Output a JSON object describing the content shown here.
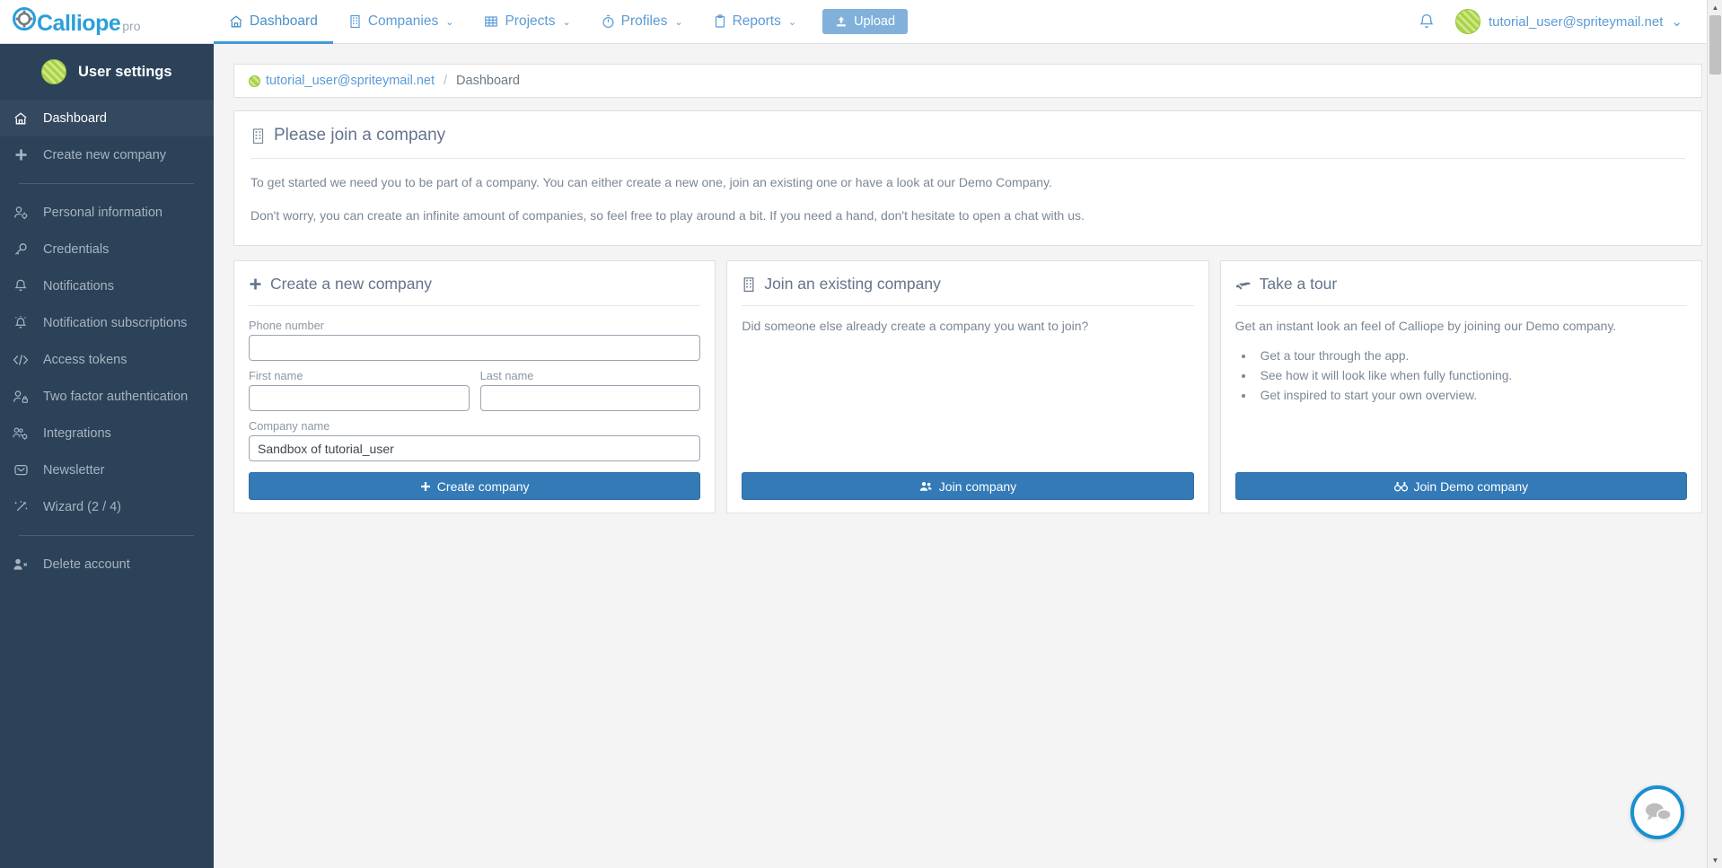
{
  "brand": {
    "name": "Calliope",
    "suffix": "pro"
  },
  "topnav": {
    "items": [
      {
        "label": "Dashboard",
        "icon": "home-icon",
        "caret": "",
        "active": true
      },
      {
        "label": "Companies",
        "icon": "building-icon",
        "caret": "⌄",
        "active": false
      },
      {
        "label": "Projects",
        "icon": "table-icon",
        "caret": "⌄",
        "active": false
      },
      {
        "label": "Profiles",
        "icon": "stopwatch-icon",
        "caret": "⌄",
        "active": false
      },
      {
        "label": "Reports",
        "icon": "clipboard-icon",
        "caret": "⌄",
        "active": false
      }
    ],
    "upload_label": "Upload",
    "notifications_icon": "bell-icon",
    "user_label": "tutorial_user@spriteymail.net",
    "user_caret": "⌄"
  },
  "sidebar": {
    "header_label": "User settings",
    "items": [
      {
        "label": "Dashboard",
        "icon": "home-icon",
        "active": true
      },
      {
        "label": "Create new company",
        "icon": "plus-icon",
        "active": false
      },
      {
        "label": "Personal information",
        "icon": "user-gear-icon",
        "active": false
      },
      {
        "label": "Credentials",
        "icon": "key-icon",
        "active": false
      },
      {
        "label": "Notifications",
        "icon": "bell-icon",
        "active": false
      },
      {
        "label": "Notification subscriptions",
        "icon": "bell-ring-icon",
        "active": false
      },
      {
        "label": "Access tokens",
        "icon": "code-icon",
        "active": false
      },
      {
        "label": "Two factor authentication",
        "icon": "user-lock-icon",
        "active": false
      },
      {
        "label": "Integrations",
        "icon": "users-gear-icon",
        "active": false
      },
      {
        "label": "Newsletter",
        "icon": "envelope-icon",
        "active": false
      },
      {
        "label": "Wizard (2 / 4)",
        "icon": "magic-wand-icon",
        "active": false
      },
      {
        "label": "Delete account",
        "icon": "user-remove-icon",
        "active": false
      }
    ]
  },
  "breadcrumb": {
    "root_label": "tutorial_user@spriteymail.net",
    "separator": "/",
    "current_label": "Dashboard"
  },
  "main_panel": {
    "title": "Please join a company",
    "title_icon": "building-icon",
    "paragraph_1": "To get started we need you to be part of a company. You can either create a new one, join an existing one or have a look at our Demo Company.",
    "paragraph_2": "Don't worry, you can create an infinite amount of companies, so feel free to play around a bit. If you need a hand, don't hesitate to open a chat with us."
  },
  "cards": {
    "create": {
      "title": "Create a new company",
      "title_icon": "plus-icon",
      "fields": {
        "phone_label": "Phone number",
        "phone_value": "",
        "phone_placeholder": "",
        "first_name_label": "First name",
        "first_name_value": "",
        "first_name_placeholder": "",
        "last_name_label": "Last name",
        "last_name_value": "",
        "last_name_placeholder": "",
        "company_name_label": "Company name",
        "company_name_value": "Sandbox of tutorial_user",
        "company_name_placeholder": ""
      },
      "button_label": "Create company",
      "button_icon": "plus-icon"
    },
    "join": {
      "title": "Join an existing company",
      "title_icon": "building-icon",
      "text": "Did someone else already create a company you want to join?",
      "button_label": "Join company",
      "button_icon": "users-icon"
    },
    "tour": {
      "title": "Take a tour",
      "title_icon": "plane-icon",
      "text": "Get an instant look an feel of Calliope by joining our Demo company.",
      "bullets": [
        "Get a tour through the app.",
        "See how it will look like when fully functioning.",
        "Get inspired to start your own overview."
      ],
      "button_label": "Join Demo company",
      "button_icon": "binoculars-icon"
    }
  },
  "chat": {
    "icon": "chat-bubbles-icon"
  },
  "scrollbar": {
    "up_arrow": "▲",
    "down_arrow": "▼"
  },
  "colors": {
    "sidebar_bg": "#2b4258",
    "sidebar_active_bg": "#34495f",
    "nav_link": "#5b9bd5",
    "accent_underline": "#3f9ad8",
    "primary_button": "#337ab7",
    "upload_button": "#81b1da",
    "chat_ring": "#1a8fd1",
    "page_bg": "#f4f4f4"
  }
}
